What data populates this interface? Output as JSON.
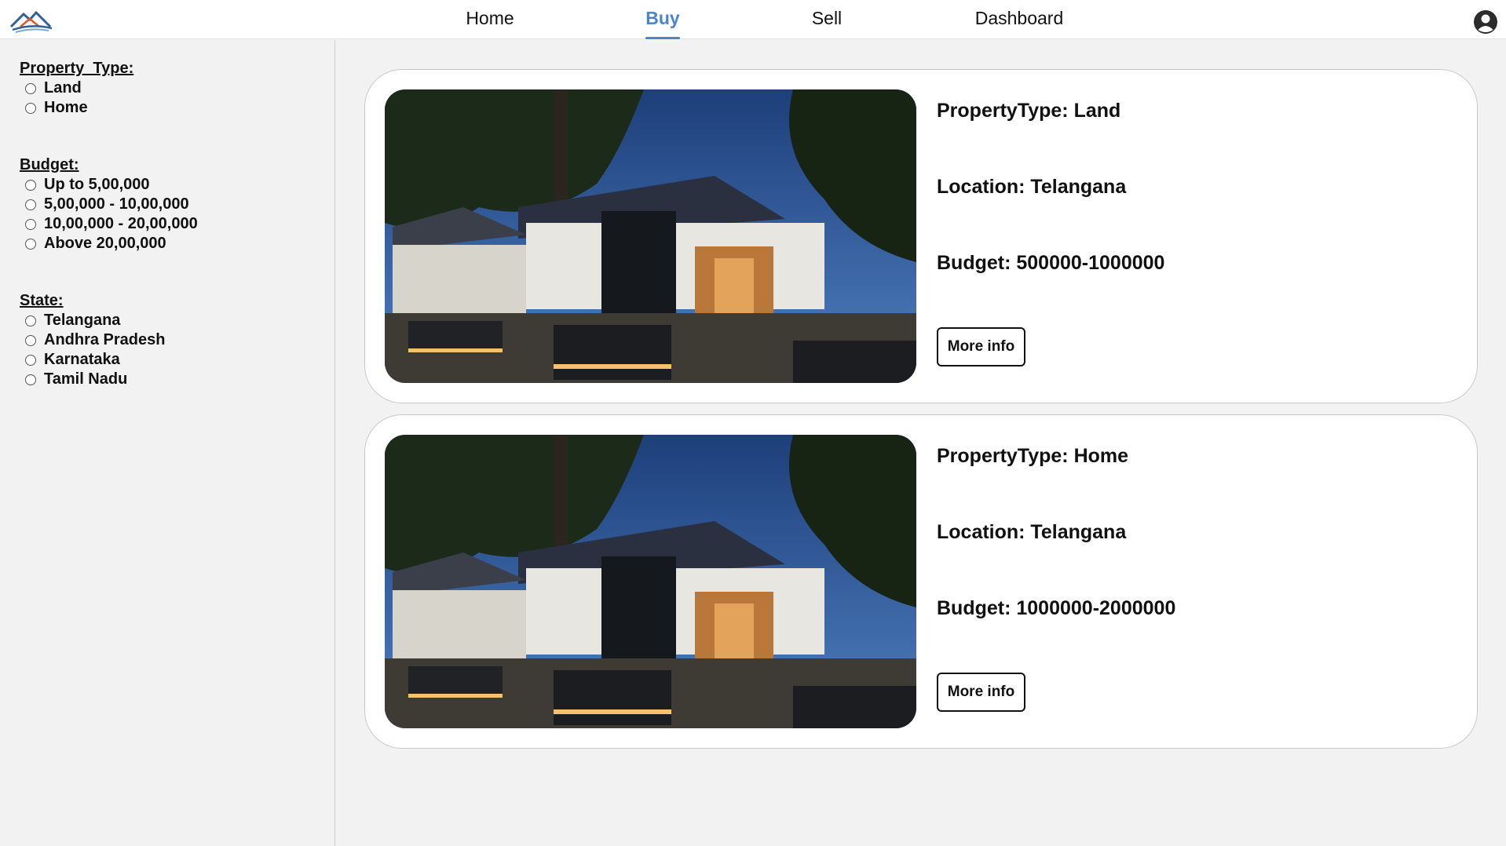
{
  "nav": {
    "links": [
      "Home",
      "Buy",
      "Sell",
      "Dashboard"
    ],
    "active": "Buy",
    "accent_color": "#4a86c8",
    "logo_icon": "house-mountain-logo",
    "user_icon": "user-avatar-icon"
  },
  "filters": {
    "property_type": {
      "title": "Property_Type:",
      "options": [
        "Land",
        "Home"
      ]
    },
    "budget": {
      "title": "Budget:",
      "options": [
        "Up to 5,00,000",
        "5,00,000 - 10,00,000",
        "10,00,000 - 20,00,000",
        "Above 20,00,000"
      ]
    },
    "state": {
      "title": "State:",
      "options": [
        "Telangana",
        "Andhra Pradesh",
        "Karnataka",
        "Tamil Nadu"
      ]
    }
  },
  "listings": [
    {
      "property_type": "PropertyType: Land",
      "location": "Location: Telangana",
      "budget": "Budget: 500000-1000000",
      "button": "More info"
    },
    {
      "property_type": "PropertyType: Home",
      "location": "Location: Telangana",
      "budget": "Budget: 1000000-2000000",
      "button": "More info"
    }
  ]
}
